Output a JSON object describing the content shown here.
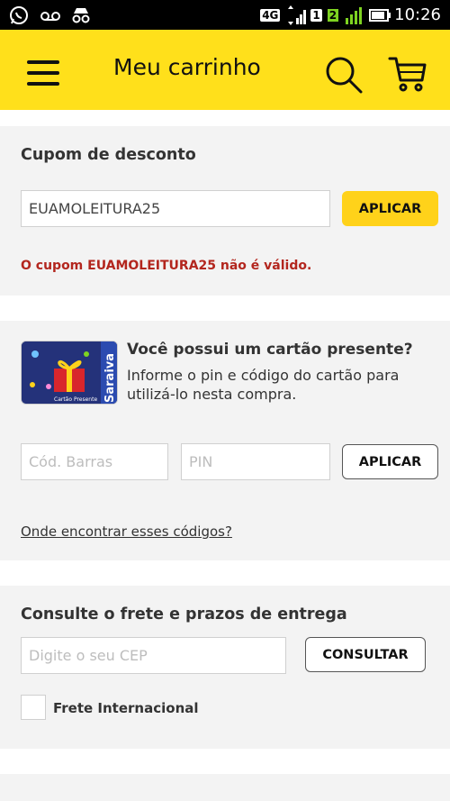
{
  "status_bar": {
    "network": "4G",
    "sim1": "1",
    "sim2": "2",
    "time": "10:26"
  },
  "app_bar": {
    "title": "Meu carrinho"
  },
  "coupon": {
    "title": "Cupom de desconto",
    "input_value": "EUAMOLEITURA25",
    "apply_label": "APLICAR",
    "error": "O cupom EUAMOLEITURA25 não é válido."
  },
  "gift": {
    "title": "Você possui um cartão presente?",
    "description": "Informe o pin e código do cartão para utilizá-lo nesta compra.",
    "barcode_placeholder": "Cód. Barras",
    "pin_placeholder": "PIN",
    "apply_label": "APLICAR",
    "help_link": "Onde encontrar esses códigos?",
    "card_brand": "Saraiva",
    "card_caption": "Cartão Presente"
  },
  "shipping": {
    "title": "Consulte o frete e prazos de entrega",
    "cep_placeholder": "Digite o seu CEP",
    "consult_label": "CONSULTAR",
    "international_label": "Frete Internacional"
  },
  "colors": {
    "brand_yellow": "#ffe01b",
    "button_yellow": "#ffd21a",
    "error_red": "#b3261e"
  }
}
